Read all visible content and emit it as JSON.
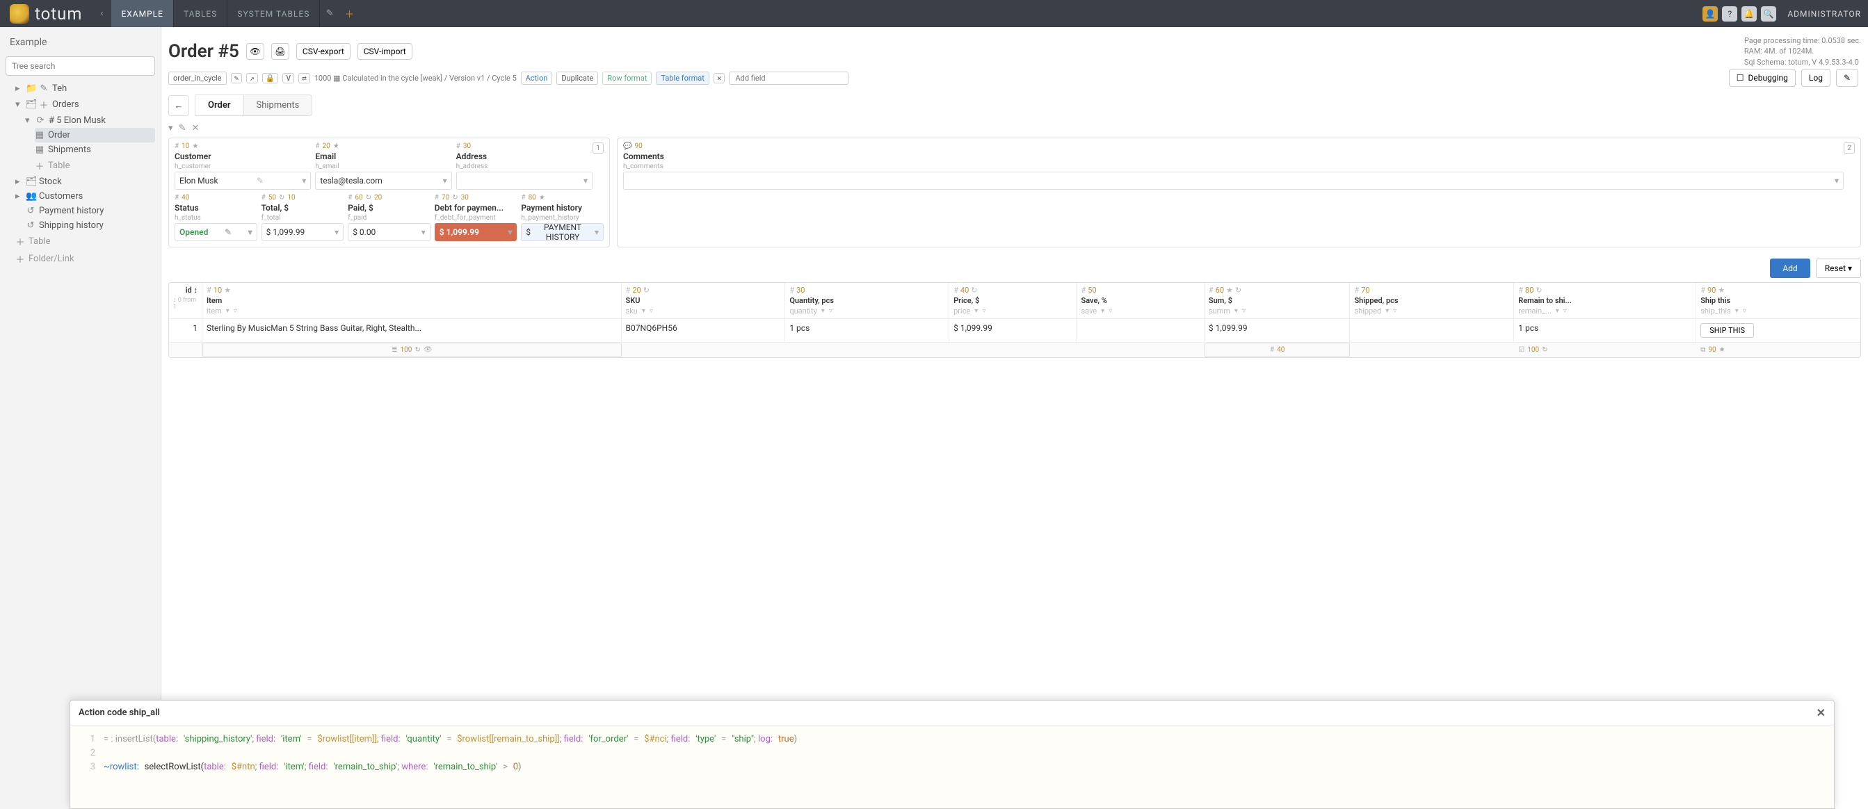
{
  "top": {
    "brand": "totum",
    "tabs": [
      "EXAMPLE",
      "TABLES",
      "SYSTEM TABLES"
    ],
    "active_tab_index": 0,
    "admin": "ADMINISTRATOR",
    "right_icons": [
      "user-icon",
      "question-icon",
      "bell-icon",
      "search-icon"
    ]
  },
  "sidebar": {
    "title": "Example",
    "search_placeholder": "Tree search",
    "nodes": {
      "teh": "Teh",
      "orders": "Orders",
      "order_num": "# 5 Elon Musk",
      "order_node": "Order",
      "shipments_node": "Shipments",
      "table_node": "Table",
      "stock": "Stock",
      "customers": "Customers",
      "payment_history": "Payment history",
      "shipping_history": "Shipping history",
      "table2": "Table",
      "folder_link": "Folder/Link"
    }
  },
  "header": {
    "title": "Order #5",
    "csv_export": "CSV-export",
    "csv_import": "CSV-import",
    "cycle_name": "order_in_cycle",
    "cycle_text": "1000 ▦ Calculated in the cycle [weak] / Version v1 / Cycle 5",
    "chips": {
      "action": "Action",
      "duplicate": "Duplicate",
      "row_format": "Row format",
      "table_format": "Table format"
    },
    "add_field": "Add field",
    "page_meta": {
      "line1": "Page processing time: 0.0538 sec.",
      "line2": "RAM: 4M. of 1024M.",
      "line3": "Sql Schema: totum, V 4.9.53.3-4.0"
    },
    "debugging": "Debugging",
    "log": "Log"
  },
  "tabs": {
    "back": "←",
    "order": "Order",
    "shipments": "Shipments"
  },
  "panel1": {
    "badge": "1",
    "row1": [
      {
        "meta": "10",
        "star": true,
        "label": "Customer",
        "sys": "h_customer",
        "value": "Elon Musk",
        "dd": true,
        "pencil": true
      },
      {
        "meta": "20",
        "star": true,
        "label": "Email",
        "sys": "h_email",
        "value": "tesla@tesla.com",
        "dd": true
      },
      {
        "meta": "30",
        "label": "Address",
        "sys": "h_address",
        "value": "",
        "dd": true
      }
    ],
    "row2": [
      {
        "meta": "40",
        "label": "Status",
        "sys": "h_status",
        "value": "Opened",
        "cls": "green",
        "dd": true,
        "pencil": true
      },
      {
        "meta": "50",
        "meta2": "10",
        "label": "Total, $",
        "sys": "f_total",
        "value": "$ 1,099.99",
        "dd": true
      },
      {
        "meta": "60",
        "meta2": "20",
        "label": "Paid, $",
        "sys": "f_paid",
        "value": "$ 0.00",
        "dd": true
      },
      {
        "meta": "70",
        "meta2": "30",
        "label": "Debt for paymen...",
        "sys": "f_debt_for_payment",
        "value": "$ 1,099.99",
        "cls": "red",
        "dd": true
      },
      {
        "meta": "80",
        "star": true,
        "label": "Payment history",
        "sys": "h_payment_history",
        "btn": "PAYMENT HISTORY",
        "prefix": "$",
        "dd": true
      }
    ]
  },
  "panel2": {
    "badge": "2",
    "field": {
      "meta": "90",
      "label": "Comments",
      "sys": "h_comments",
      "value": "",
      "dd": true
    }
  },
  "grid": {
    "add": "Add",
    "reset": "Reset",
    "id_header": "id",
    "id_sort": "↕ 0 from 1",
    "columns": [
      {
        "meta": "10",
        "star": true,
        "title": "Item",
        "sys": "item"
      },
      {
        "meta": "20",
        "loop": true,
        "title": "SKU",
        "sys": "sku"
      },
      {
        "meta": "30",
        "title": "Quantity, pcs",
        "sys": "quantity"
      },
      {
        "meta": "40",
        "loop": true,
        "title": "Price, $",
        "sys": "price"
      },
      {
        "meta": "50",
        "title": "Save, %",
        "sys": "save"
      },
      {
        "meta": "60",
        "star": true,
        "loop": true,
        "title": "Sum, $",
        "sys": "summ"
      },
      {
        "meta": "70",
        "title": "Shipped, pcs",
        "sys": "shipped"
      },
      {
        "meta": "80",
        "loop": true,
        "title": "Remain to shi...",
        "sys": "remain_..."
      },
      {
        "meta": "90",
        "star": true,
        "title": "Ship this",
        "sys": "ship_this"
      }
    ],
    "rows": [
      {
        "id": "1",
        "item": "Sterling By MusicMan 5 String Bass Guitar, Right, Stealth...",
        "sku": "B07NQ6PH56",
        "qty": "1 pcs",
        "price": "$ 1,099.99",
        "save": "",
        "sum": "$ 1,099.99",
        "shipped": "",
        "remain": "1 pcs",
        "ship_btn": "SHIP THIS"
      }
    ],
    "footer": {
      "item_meta": "100",
      "sum_meta": "40",
      "remain_meta": "100",
      "ship_meta": "90"
    }
  },
  "code": {
    "title": "Action code ship_all",
    "lines": {
      "l1_pre": "= : insertList(",
      "table_kw": "table",
      "colon": ":",
      "l1_tbl": "'shipping_history'",
      "field_kw": "field",
      "l1_f1": "'item'",
      "eq": "=",
      "l1_v1": "$rowlist[[item]]",
      "l1_f2": "'quantity'",
      "l1_v2": "$rowlist[[remain_to_ship]]",
      "l1_f3": "'for_order'",
      "l1_v3": "$#nci",
      "l1_f4": "'type'",
      "l1_v4": "\"ship\"",
      "log_kw": "log",
      "l1_true": "true",
      "l3_var": "~rowlist",
      "l3_fn": "selectRowList(",
      "l3_tbl": "$#ntn",
      "l3_f1": "'item'",
      "l3_f2": "'remain_to_ship'",
      "where_kw": "where",
      "l3_w": "'remain_to_ship'",
      "gt": ">",
      "zero": "0"
    }
  }
}
